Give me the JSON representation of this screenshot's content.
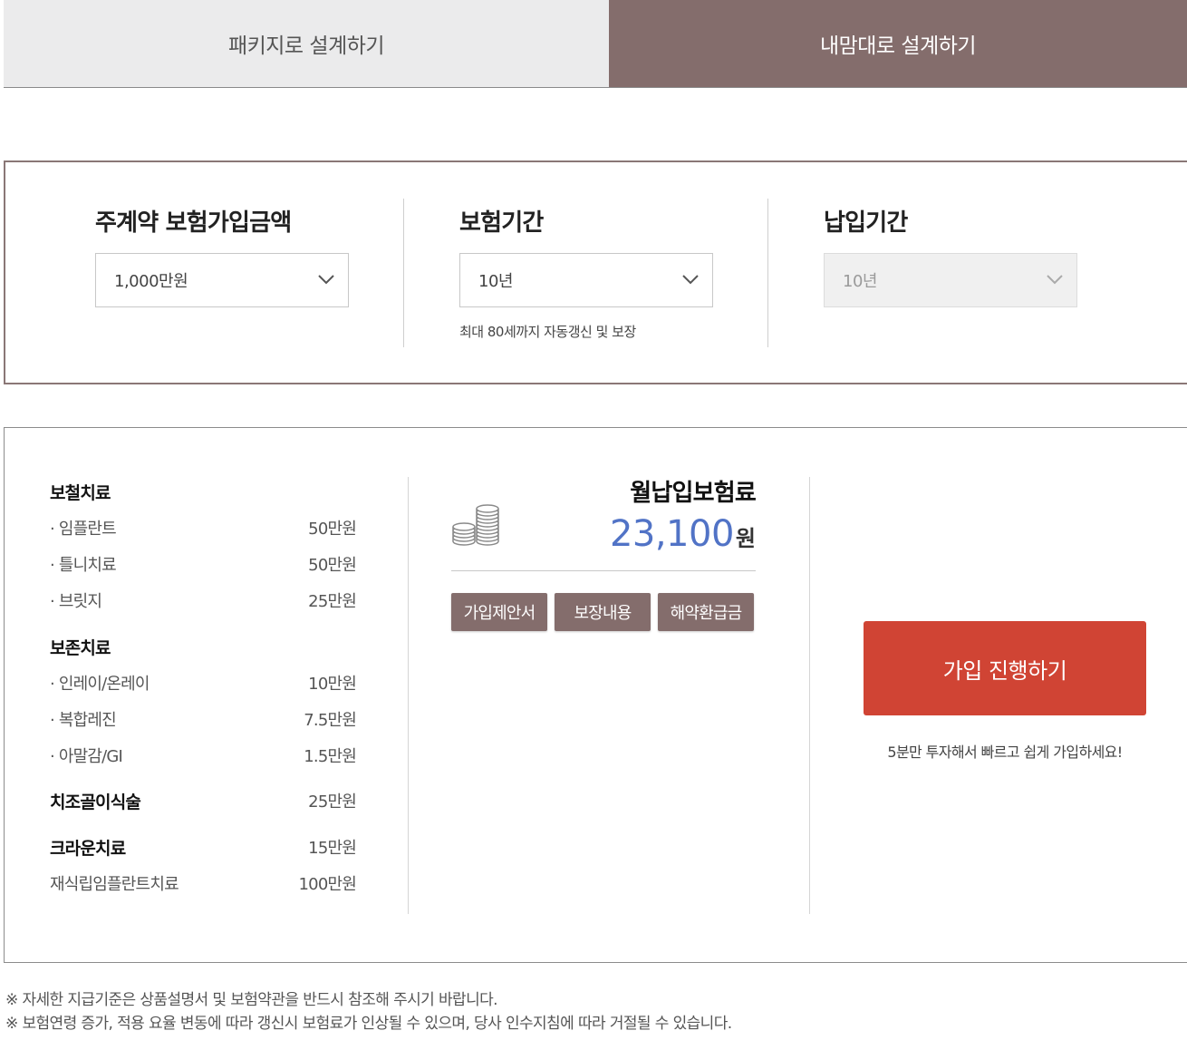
{
  "tabs": [
    {
      "label": "패키지로 설계하기",
      "active": false
    },
    {
      "label": "내맘대로 설계하기",
      "active": true
    }
  ],
  "selectors": {
    "amount": {
      "title": "주계약 보험가입금액",
      "value": "1,000만원"
    },
    "period": {
      "title": "보험기간",
      "value": "10년",
      "note": "최대 80세까지 자동갱신 및 보장"
    },
    "payment": {
      "title": "납입기간",
      "value": "10년",
      "disabled": true
    }
  },
  "coverage": {
    "c1": {
      "title": "보철치료"
    },
    "i1": {
      "label": "· 임플란트",
      "amount": "50만원"
    },
    "i2": {
      "label": "· 틀니치료",
      "amount": "50만원"
    },
    "i3": {
      "label": "· 브릿지",
      "amount": "25만원"
    },
    "c2": {
      "title": "보존치료"
    },
    "i4": {
      "label": "· 인레이/온레이",
      "amount": "10만원"
    },
    "i5": {
      "label": "· 복합레진",
      "amount": "7.5만원"
    },
    "i6": {
      "label": "· 아말감/GI",
      "amount": "1.5만원"
    },
    "c3": {
      "title": "치조골이식술",
      "amount": "25만원"
    },
    "c4": {
      "title": "크라운치료",
      "amount": "15만원"
    },
    "i7": {
      "label": "재식립임플란트치료",
      "amount": "100만원"
    }
  },
  "premium": {
    "label": "월납입보험료",
    "amount": "23,100",
    "unit": "원",
    "buttons": [
      "가입제안서",
      "보장내용",
      "해약환급금"
    ]
  },
  "cta": {
    "label": "가입 진행하기",
    "sub": "5분만 투자해서 빠르고 쉽게 가입하세요!"
  },
  "footnotes": [
    "※ 자세한 지급기준은 상품설명서 및 보험약관을 반드시 참조해 주시기 바랍니다.",
    "※ 보험연령 증가, 적용 요율 변동에 따라 갱신시 보험료가 인상될 수 있으며, 당사 인수지침에 따라 거절될 수 있습니다."
  ],
  "colors": {
    "accent": "#846d6c",
    "cta": "#d04434",
    "premium_blue": "#5173c6"
  }
}
